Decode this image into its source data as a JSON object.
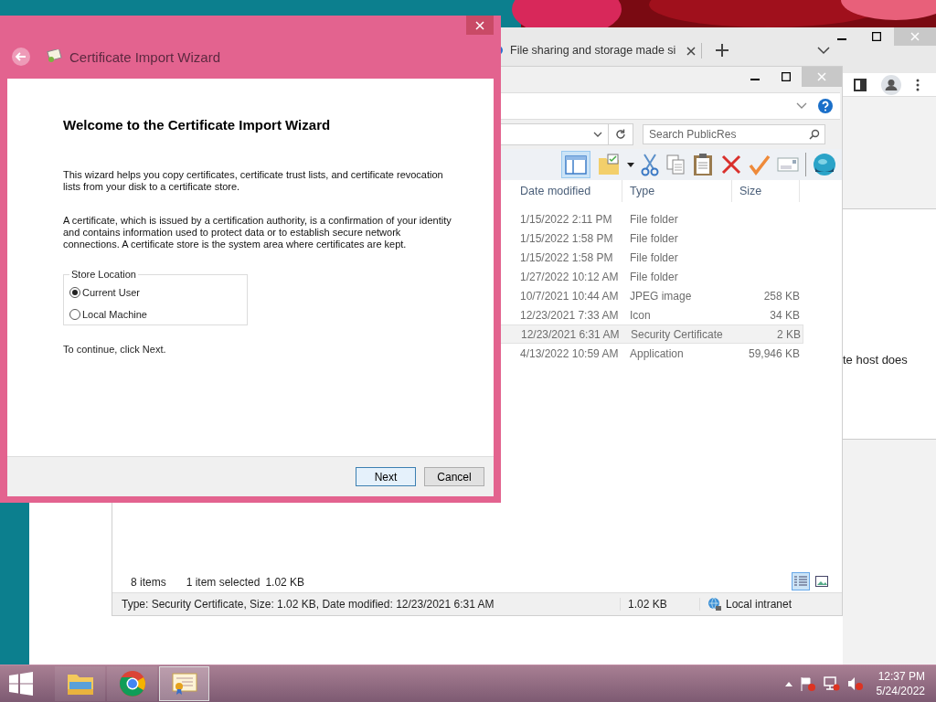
{
  "browser": {
    "tab_title": "File sharing and storage made si",
    "page_text": "te host does"
  },
  "explorer": {
    "search": {
      "placeholder": "Search PublicRes"
    },
    "columns": [
      "Date modified",
      "Type",
      "Size"
    ],
    "rows": [
      {
        "date": "1/15/2022 2:11 PM",
        "type": "File folder",
        "selected": false
      },
      {
        "date": "1/15/2022 1:58 PM",
        "type": "File folder",
        "selected": false
      },
      {
        "date": "1/15/2022 1:58 PM",
        "type": "File folder",
        "selected": false
      },
      {
        "date": "1/27/2022 10:12 AM",
        "type": "File folder",
        "selected": false
      },
      {
        "date": "10/7/2021 10:44 AM",
        "type": "JPEG image",
        "size": "258 KB",
        "selected": false
      },
      {
        "date": "12/23/2021 7:33 AM",
        "type": "Icon",
        "size": "34 KB",
        "selected": false
      },
      {
        "date": "12/23/2021 6:31 AM",
        "type": "Security Certificate",
        "size": "2 KB",
        "selected": true
      },
      {
        "date": "4/13/2022 10:59 AM",
        "type": "Application",
        "size": "59,946 KB",
        "selected": false
      }
    ],
    "item_count": "8 items",
    "selection": "1 item selected",
    "selection_size": "1.02 KB",
    "view_buttons": [
      {
        "kind": "details",
        "selected": true
      },
      {
        "kind": "preview",
        "selected": false
      }
    ],
    "status_bar": {
      "details": "Type: Security Certificate, Size: 1.02 KB, Date modified: 12/23/2021 6:31 AM",
      "size": "1.02 KB",
      "zone": "Local intranet"
    }
  },
  "wizard": {
    "title": "Certificate Import Wizard",
    "heading": "Welcome to the Certificate Import Wizard",
    "paragraphs": [
      "This wizard helps you copy certificates, certificate trust lists, and certificate revocation lists from your disk to a certificate store.",
      "A certificate, which is issued by a certification authority, is a confirmation of your identity and contains information used to protect data or to establish secure network connections. A certificate store is the system area where certificates are kept."
    ],
    "store_location": {
      "legend": "Store Location",
      "options": [
        {
          "label": "Current User",
          "selected": true
        },
        {
          "label": "Local Machine",
          "selected": false
        }
      ]
    },
    "instruction": "To continue, click Next.",
    "buttons": [
      {
        "label": "Next",
        "default": true
      },
      {
        "label": "Cancel",
        "default": false
      }
    ]
  },
  "taskbar": {
    "apps": [
      {
        "kind": "explorer",
        "active": false
      },
      {
        "kind": "chrome",
        "active": false
      },
      {
        "kind": "certificate",
        "active": true
      }
    ],
    "clock": {
      "time": "12:37 PM",
      "date": "5/24/2022"
    }
  }
}
